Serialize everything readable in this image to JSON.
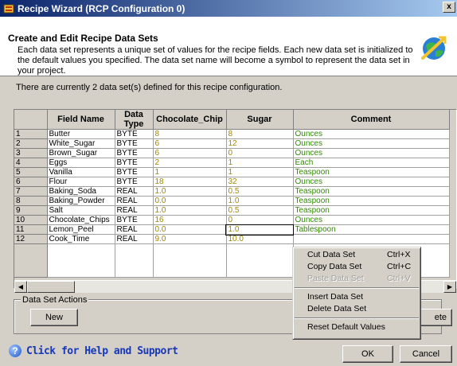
{
  "window": {
    "title": "Recipe Wizard (RCP Configuration 0)",
    "close_label": "x"
  },
  "header": {
    "title": "Create and Edit Recipe Data Sets",
    "description": "Each data set represents a unique set of values for the recipe fields. Each new data set is initialized to the default values you specified. The data set name will become a symbol to represent the data set in your project."
  },
  "info_line": "There are currently 2 data set(s) defined for this recipe configuration.",
  "grid": {
    "columns": [
      "",
      "Field Name",
      "Data Type",
      "Chocolate_Chip",
      "Sugar",
      "Comment"
    ],
    "rows": [
      [
        "1",
        "Butter",
        "BYTE",
        "8",
        "8",
        "Ounces"
      ],
      [
        "2",
        "White_Sugar",
        "BYTE",
        "6",
        "12",
        "Ounces"
      ],
      [
        "3",
        "Brown_Sugar",
        "BYTE",
        "6",
        "0",
        "Ounces"
      ],
      [
        "4",
        "Eggs",
        "BYTE",
        "2",
        "1",
        "Each"
      ],
      [
        "5",
        "Vanilla",
        "BYTE",
        "1",
        "1",
        "Teaspoon"
      ],
      [
        "6",
        "Flour",
        "BYTE",
        "18",
        "32",
        "Ounces"
      ],
      [
        "7",
        "Baking_Soda",
        "REAL",
        "1.0",
        "0.5",
        "Teaspoon"
      ],
      [
        "8",
        "Baking_Powder",
        "REAL",
        "0.0",
        "1.0",
        "Teaspoon"
      ],
      [
        "9",
        "Salt",
        "REAL",
        "1.0",
        "0.5",
        "Teaspoon"
      ],
      [
        "10",
        "Chocolate_Chips",
        "BYTE",
        "16",
        "0",
        "Ounces"
      ],
      [
        "11",
        "Lemon_Peel",
        "REAL",
        "0.0",
        "1.0",
        "Tablespoon"
      ],
      [
        "12",
        "Cook_Time",
        "REAL",
        "9.0",
        "10.0",
        ""
      ]
    ]
  },
  "data_set_actions": {
    "label": "Data Set Actions",
    "new_label": "New",
    "delete_label": "ete"
  },
  "context_menu": {
    "items": [
      {
        "label": "Cut Data Set",
        "shortcut": "Ctrl+X",
        "enabled": true
      },
      {
        "label": "Copy Data Set",
        "shortcut": "Ctrl+C",
        "enabled": true
      },
      {
        "label": "Paste Data Set",
        "shortcut": "Ctrl+V",
        "enabled": false
      },
      {
        "label": "Insert Data Set",
        "shortcut": "",
        "enabled": true
      },
      {
        "label": "Delete Data Set",
        "shortcut": "",
        "enabled": true
      },
      {
        "label": "Reset Default Values",
        "shortcut": "",
        "enabled": true
      }
    ]
  },
  "footer": {
    "help_label": "Click for Help and Support",
    "ok_label": "OK",
    "cancel_label": "Cancel"
  },
  "colors": {
    "title_gradient_start": "#0a246a",
    "value_text": "#a08800",
    "comment_text": "#2e8b00",
    "help_link": "#1738b8"
  },
  "icons": {
    "app": "recipe-app-icon",
    "wizard": "wizard-globe-icon",
    "help": "help-icon"
  }
}
